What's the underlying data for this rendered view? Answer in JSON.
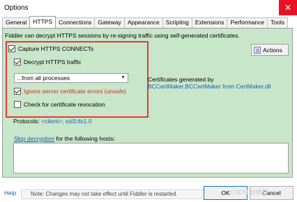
{
  "window": {
    "title": "Options",
    "close_glyph": "✕"
  },
  "tabs": [
    {
      "label": "General"
    },
    {
      "label": "HTTPS"
    },
    {
      "label": "Connections"
    },
    {
      "label": "Gateway"
    },
    {
      "label": "Appearance"
    },
    {
      "label": "Scripting"
    },
    {
      "label": "Extensions"
    },
    {
      "label": "Performance"
    },
    {
      "label": "Tools"
    }
  ],
  "https": {
    "description": "Fiddler can decrypt HTTPS sessions by re-signing traffic using self-generated certificates.",
    "capture_label": "Capture HTTPS CONNECTs",
    "decrypt_label": "Decrypt HTTPS traffic",
    "process_filter": "...from all processes",
    "ignore_errors_label": "Ignore server certificate errors (unsafe)",
    "revocation_label": "Check for certificate revocation",
    "certs_generated_label": "Certificates generated by",
    "certs_generated_value": "BCCertMaker.BCCertMaker from CertMaker.dll",
    "actions_label": "Actions",
    "protocols_label": "Protocols:",
    "protocols_value": "<client>; ssl3;tls1.0",
    "skip_link": "Skip decryption",
    "skip_suffix": " for the following hosts:"
  },
  "footer": {
    "help": "Help",
    "note": "Note: Changes may not take effect until Fiddler is restarted.",
    "ok": "OK",
    "cancel": "Cancel",
    "watermark": "CSDN @桃核"
  },
  "colors": {
    "panel_bg": "#c8e6c9",
    "highlight_border": "#e53935",
    "link": "#1a5fb4",
    "warning_text": "#d32f2f",
    "close_button": "#e81123"
  }
}
